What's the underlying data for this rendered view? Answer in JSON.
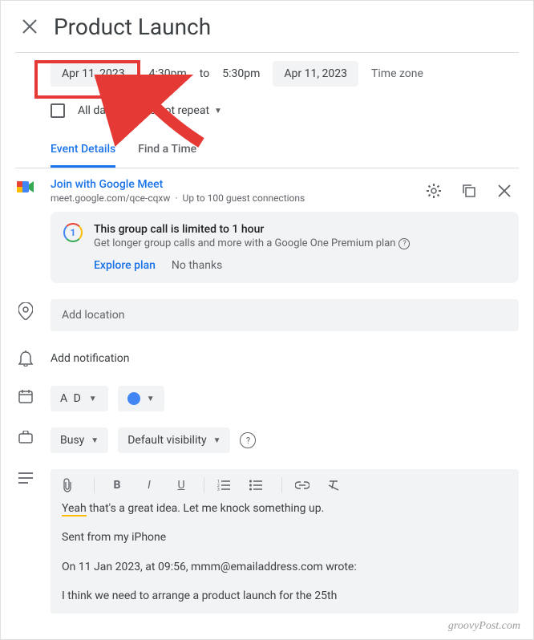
{
  "header": {
    "title": "Product Launch"
  },
  "time": {
    "start_date": "Apr 11, 2023",
    "start_time": "4:30pm",
    "to": "to",
    "end_time": "5:30pm",
    "end_date": "Apr 11, 2023",
    "timezone": "Time zone"
  },
  "options": {
    "all_day": "All day",
    "repeat": "Does not repeat"
  },
  "tabs": {
    "details": "Event Details",
    "find_time": "Find a Time"
  },
  "meet": {
    "link_label": "Join with Google Meet",
    "url": "meet.google.com/qce-cqxw",
    "guests": "Up to 100 guest connections"
  },
  "info": {
    "title": "This group call is limited to 1 hour",
    "sub": "Get longer group calls and more with a Google One Premium plan",
    "explore": "Explore plan",
    "no_thanks": "No thanks"
  },
  "location": {
    "placeholder": "Add location"
  },
  "notification": {
    "add": "Add notification"
  },
  "calendar": {
    "name": "A D"
  },
  "availability": {
    "busy": "Busy",
    "visibility": "Default visibility"
  },
  "description": {
    "line1a": "Yeah",
    "line1b": " that's a great idea. Let me knock something up.",
    "line2": "Sent from my iPhone",
    "line3": "On 11 Jan 2023, at 09:56, mmm@emailaddress.com wrote:",
    "line4": "I think we need to arrange a product launch for the 25th"
  },
  "watermark": "groovyPost.com"
}
